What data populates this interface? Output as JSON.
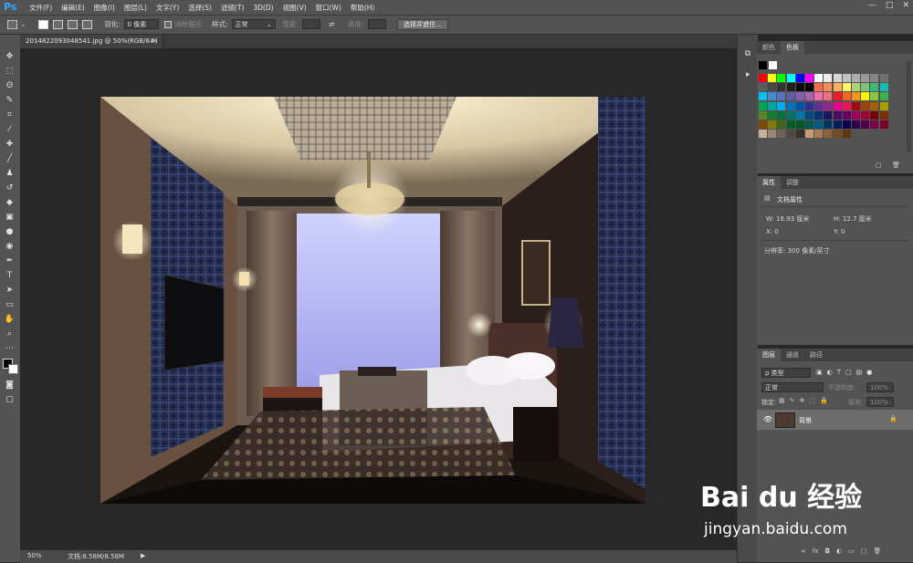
{
  "app": {
    "logo": "Ps"
  },
  "menu": [
    "文件(F)",
    "编辑(E)",
    "图像(I)",
    "图层(L)",
    "文字(Y)",
    "选择(S)",
    "滤镜(T)",
    "3D(D)",
    "视图(V)",
    "窗口(W)",
    "帮助(H)"
  ],
  "window_controls": {
    "minimize": "—",
    "maximize": "□",
    "close": "✕"
  },
  "options": {
    "feather_label": "羽化:",
    "feather_value": "0 像素",
    "antialias_label": "消除锯齿",
    "style_label": "样式:",
    "style_value": "正常",
    "width_label": "宽度:",
    "height_label": "高度:",
    "swap_icon": "⇄",
    "select_mask_button": "选择并遮住..."
  },
  "document": {
    "tab_title": "20148220930485​41.jpg @ 50%(RGB/8#)",
    "close": "×"
  },
  "status": {
    "zoom": "50%",
    "doc_size": "文档:8.58M/8.58M",
    "arrow": "▶"
  },
  "swatches_panel": {
    "tabs": [
      "颜色",
      "色板"
    ],
    "swatch_colors": [
      [
        "#ff0000",
        "#ffff00",
        "#00ff00",
        "#00ffff",
        "#0000ff",
        "#ff00ff",
        "#ffffff",
        "#ebebeb",
        "#d6d6d6",
        "#c2c2c2",
        "#adadad",
        "#999999",
        "#858585",
        "#707070"
      ],
      [
        "#5c5c5c",
        "#474747",
        "#333333",
        "#1f1f1f",
        "#0a0a0a",
        "#000000",
        "#f26c4f",
        "#f68e55",
        "#fbaf5c",
        "#fff467",
        "#acd372",
        "#7cc576",
        "#3bb878",
        "#1abbb4"
      ],
      [
        "#00bff3",
        "#438ccb",
        "#5574b9",
        "#605ca8",
        "#855fa8",
        "#a763a8",
        "#f06ea9",
        "#f26d7d",
        "#ed1c24",
        "#f26522",
        "#f7941d",
        "#fff200",
        "#8dc63f",
        "#39b54a"
      ],
      [
        "#00a651",
        "#00a99d",
        "#00aeef",
        "#0072bc",
        "#0054a6",
        "#2e3192",
        "#662d91",
        "#92278f",
        "#ec008c",
        "#ed145b",
        "#9e0b0f",
        "#a0410d",
        "#a36209",
        "#aba000"
      ],
      [
        "#598527",
        "#197b30",
        "#007236",
        "#00746b",
        "#0076a3",
        "#004a80",
        "#003471",
        "#1b1464",
        "#440e62",
        "#630460",
        "#9e005d",
        "#9e0039",
        "#790000",
        "#7b2e00"
      ],
      [
        "#7d4900",
        "#827b00",
        "#406618",
        "#005e20",
        "#005826",
        "#005952",
        "#005b7f",
        "#003663",
        "#002157",
        "#0d004c",
        "#32004b",
        "#4b0049",
        "#7b0046",
        "#7a0026"
      ]
    ],
    "skin_colors": [
      "#c7b299",
      "#998675",
      "#736357",
      "#534741",
      "#37302d",
      "#c69c6d",
      "#a67c52",
      "#8c6239",
      "#754c24",
      "#603913"
    ]
  },
  "properties_panel": {
    "tabs": [
      "属性",
      "调整"
    ],
    "section_title": "文档属性",
    "w_label": "W:",
    "w_value": "16.93 厘米",
    "h_label": "H:",
    "h_value": "12.7 厘米",
    "x_label": "X:",
    "x_value": "0",
    "y_label": "Y:",
    "y_value": "0",
    "resolution": "分辨率: 300 像素/英寸"
  },
  "layers_panel": {
    "tabs": [
      "图层",
      "通道",
      "路径"
    ],
    "filter_kind": "ρ 类型",
    "blend_mode": "正常",
    "opacity_label": "不透明度:",
    "opacity_value": "100%",
    "lock_label": "锁定:",
    "fill_label": "填充:",
    "fill_value": "100%",
    "layer_name": "背景",
    "footer_icons": [
      "∞",
      "fx",
      "◘",
      "◐",
      "▭",
      "▢",
      "🗑"
    ]
  },
  "watermark": {
    "brand": "Bai du 经验",
    "url": "jingyan.baidu.com"
  }
}
